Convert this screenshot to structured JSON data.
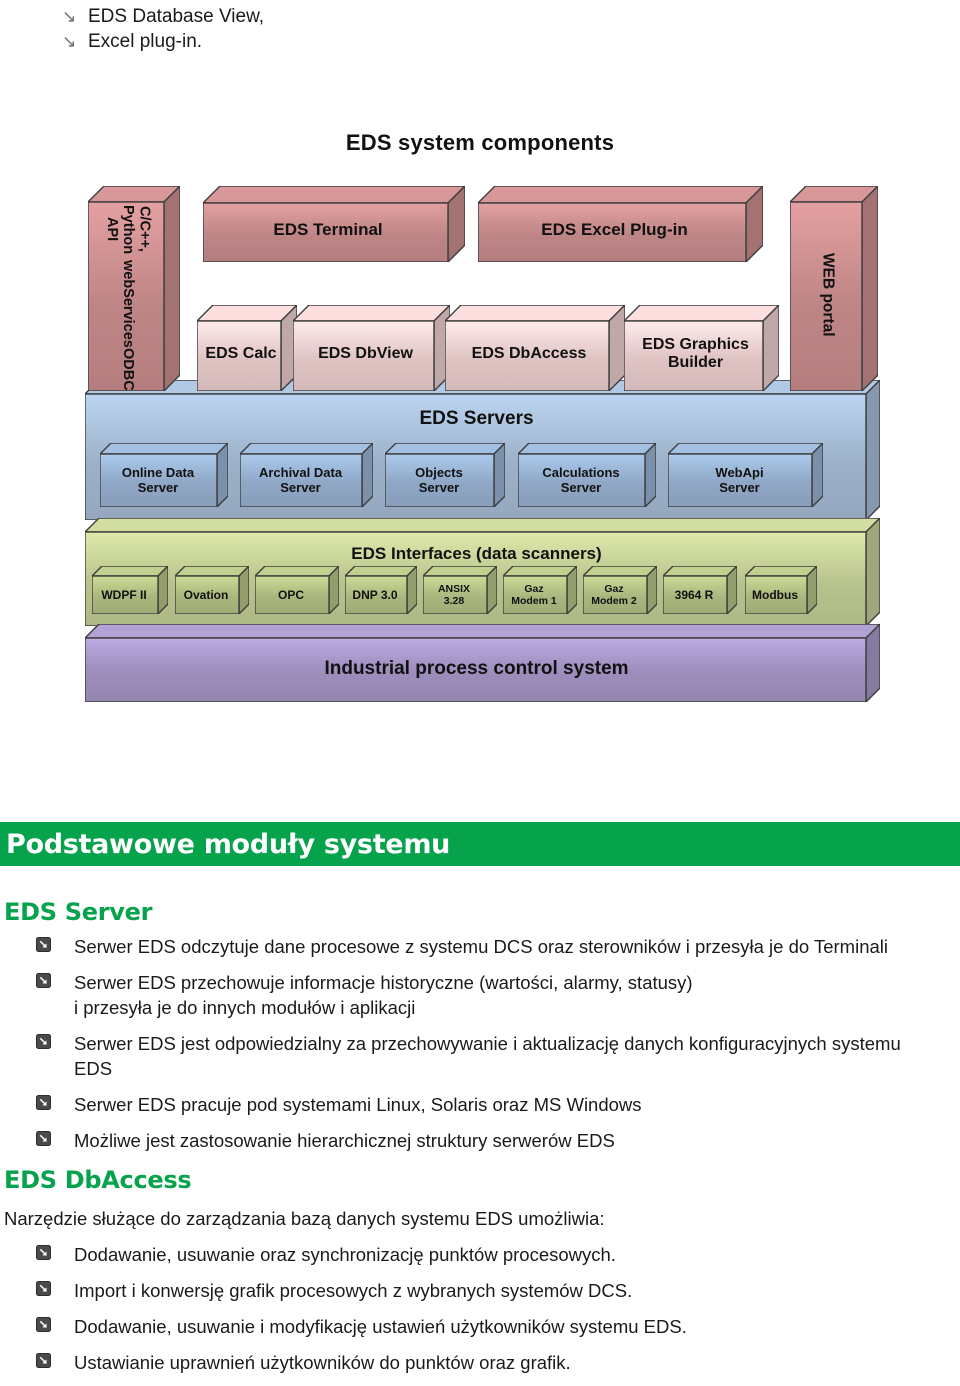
{
  "top_list": {
    "icon": "arrow-down-right-icon",
    "items": [
      "EDS Database View,",
      "Excel plug-in."
    ]
  },
  "diagram": {
    "title": "EDS system components",
    "left_pillar": {
      "label": "C/C++, Python API\nwebServices\nODBC",
      "color": "#cc8f90"
    },
    "right_pillar": {
      "label": "WEB portal",
      "color": "#cc8f90"
    },
    "top_row": [
      {
        "label": "EDS Terminal",
        "color": "#cc8f90"
      },
      {
        "label": "EDS Excel Plug-in",
        "color": "#cc8f90"
      }
    ],
    "second_row": [
      {
        "label": "EDS Calc",
        "color": "#f0d2d2"
      },
      {
        "label": "EDS DbView",
        "color": "#f0d2d2"
      },
      {
        "label": "EDS DbAccess",
        "color": "#f0d2d2"
      },
      {
        "label": "EDS Graphics Builder",
        "color": "#f0d2d2"
      }
    ],
    "servers_band": {
      "label": "EDS Servers",
      "color": "#a8bed8",
      "boxes": [
        {
          "line1": "Online Data",
          "line2": "Server"
        },
        {
          "line1": "Archival Data",
          "line2": "Server"
        },
        {
          "line1": "Objects",
          "line2": "Server"
        },
        {
          "line1": "Calculations",
          "line2": "Server"
        },
        {
          "line1": "WebApi",
          "line2": "Server"
        }
      ]
    },
    "interfaces_band": {
      "label": "EDS Interfaces (data scanners)",
      "color": "#c6d198",
      "boxes": [
        {
          "line1": "WDPF II",
          "line2": ""
        },
        {
          "line1": "Ovation",
          "line2": ""
        },
        {
          "line1": "OPC",
          "line2": ""
        },
        {
          "line1": "DNP 3.0",
          "line2": ""
        },
        {
          "line1": "ANSIX",
          "line2": "3.28"
        },
        {
          "line1": "Gaz",
          "line2": "Modem 1"
        },
        {
          "line1": "Gaz",
          "line2": "Modem 2"
        },
        {
          "line1": "3964 R",
          "line2": ""
        },
        {
          "line1": "Modbus",
          "line2": ""
        }
      ]
    },
    "process_band": {
      "label": "Industrial process control system",
      "color": "#a898c9"
    }
  },
  "section": {
    "title": "Podstawowe moduły systemu",
    "accent_color": "#07a24c"
  },
  "eds_server": {
    "heading": "EDS Server",
    "bullets": [
      {
        "line1": "Serwer EDS odczytuje dane procesowe z systemu DCS oraz sterowników i przesyła je do Terminali",
        "line2": ""
      },
      {
        "line1": "Serwer EDS przechowuje informacje historyczne (wartości, alarmy, statusy)",
        "line2": "i przesyła je do innych modułów i aplikacji"
      },
      {
        "line1": "Serwer EDS jest odpowiedzialny za przechowywanie i aktualizację danych konfiguracyjnych systemu",
        "line2": "EDS"
      },
      {
        "line1": "Serwer EDS pracuje pod systemami Linux, Solaris oraz MS Windows",
        "line2": ""
      },
      {
        "line1": "Możliwe jest zastosowanie hierarchicznej struktury serwerów EDS",
        "line2": ""
      }
    ]
  },
  "eds_dbaccess": {
    "heading": "EDS DbAccess",
    "intro": "Narzędzie służące do zarządzania bazą danych systemu EDS umożliwia:",
    "bullets": [
      {
        "line1": "Dodawanie, usuwanie oraz synchronizację punktów procesowych.",
        "line2": ""
      },
      {
        "line1": "Import i konwersję grafik procesowych z wybranych systemów DCS.",
        "line2": ""
      },
      {
        "line1": "Dodawanie, usuwanie i modyfikację ustawień użytkowników systemu EDS.",
        "line2": ""
      },
      {
        "line1": "Ustawianie uprawnień użytkowników do punktów oraz grafik.",
        "line2": ""
      }
    ]
  },
  "bullet_icon": "arrow-down-right-box-icon"
}
